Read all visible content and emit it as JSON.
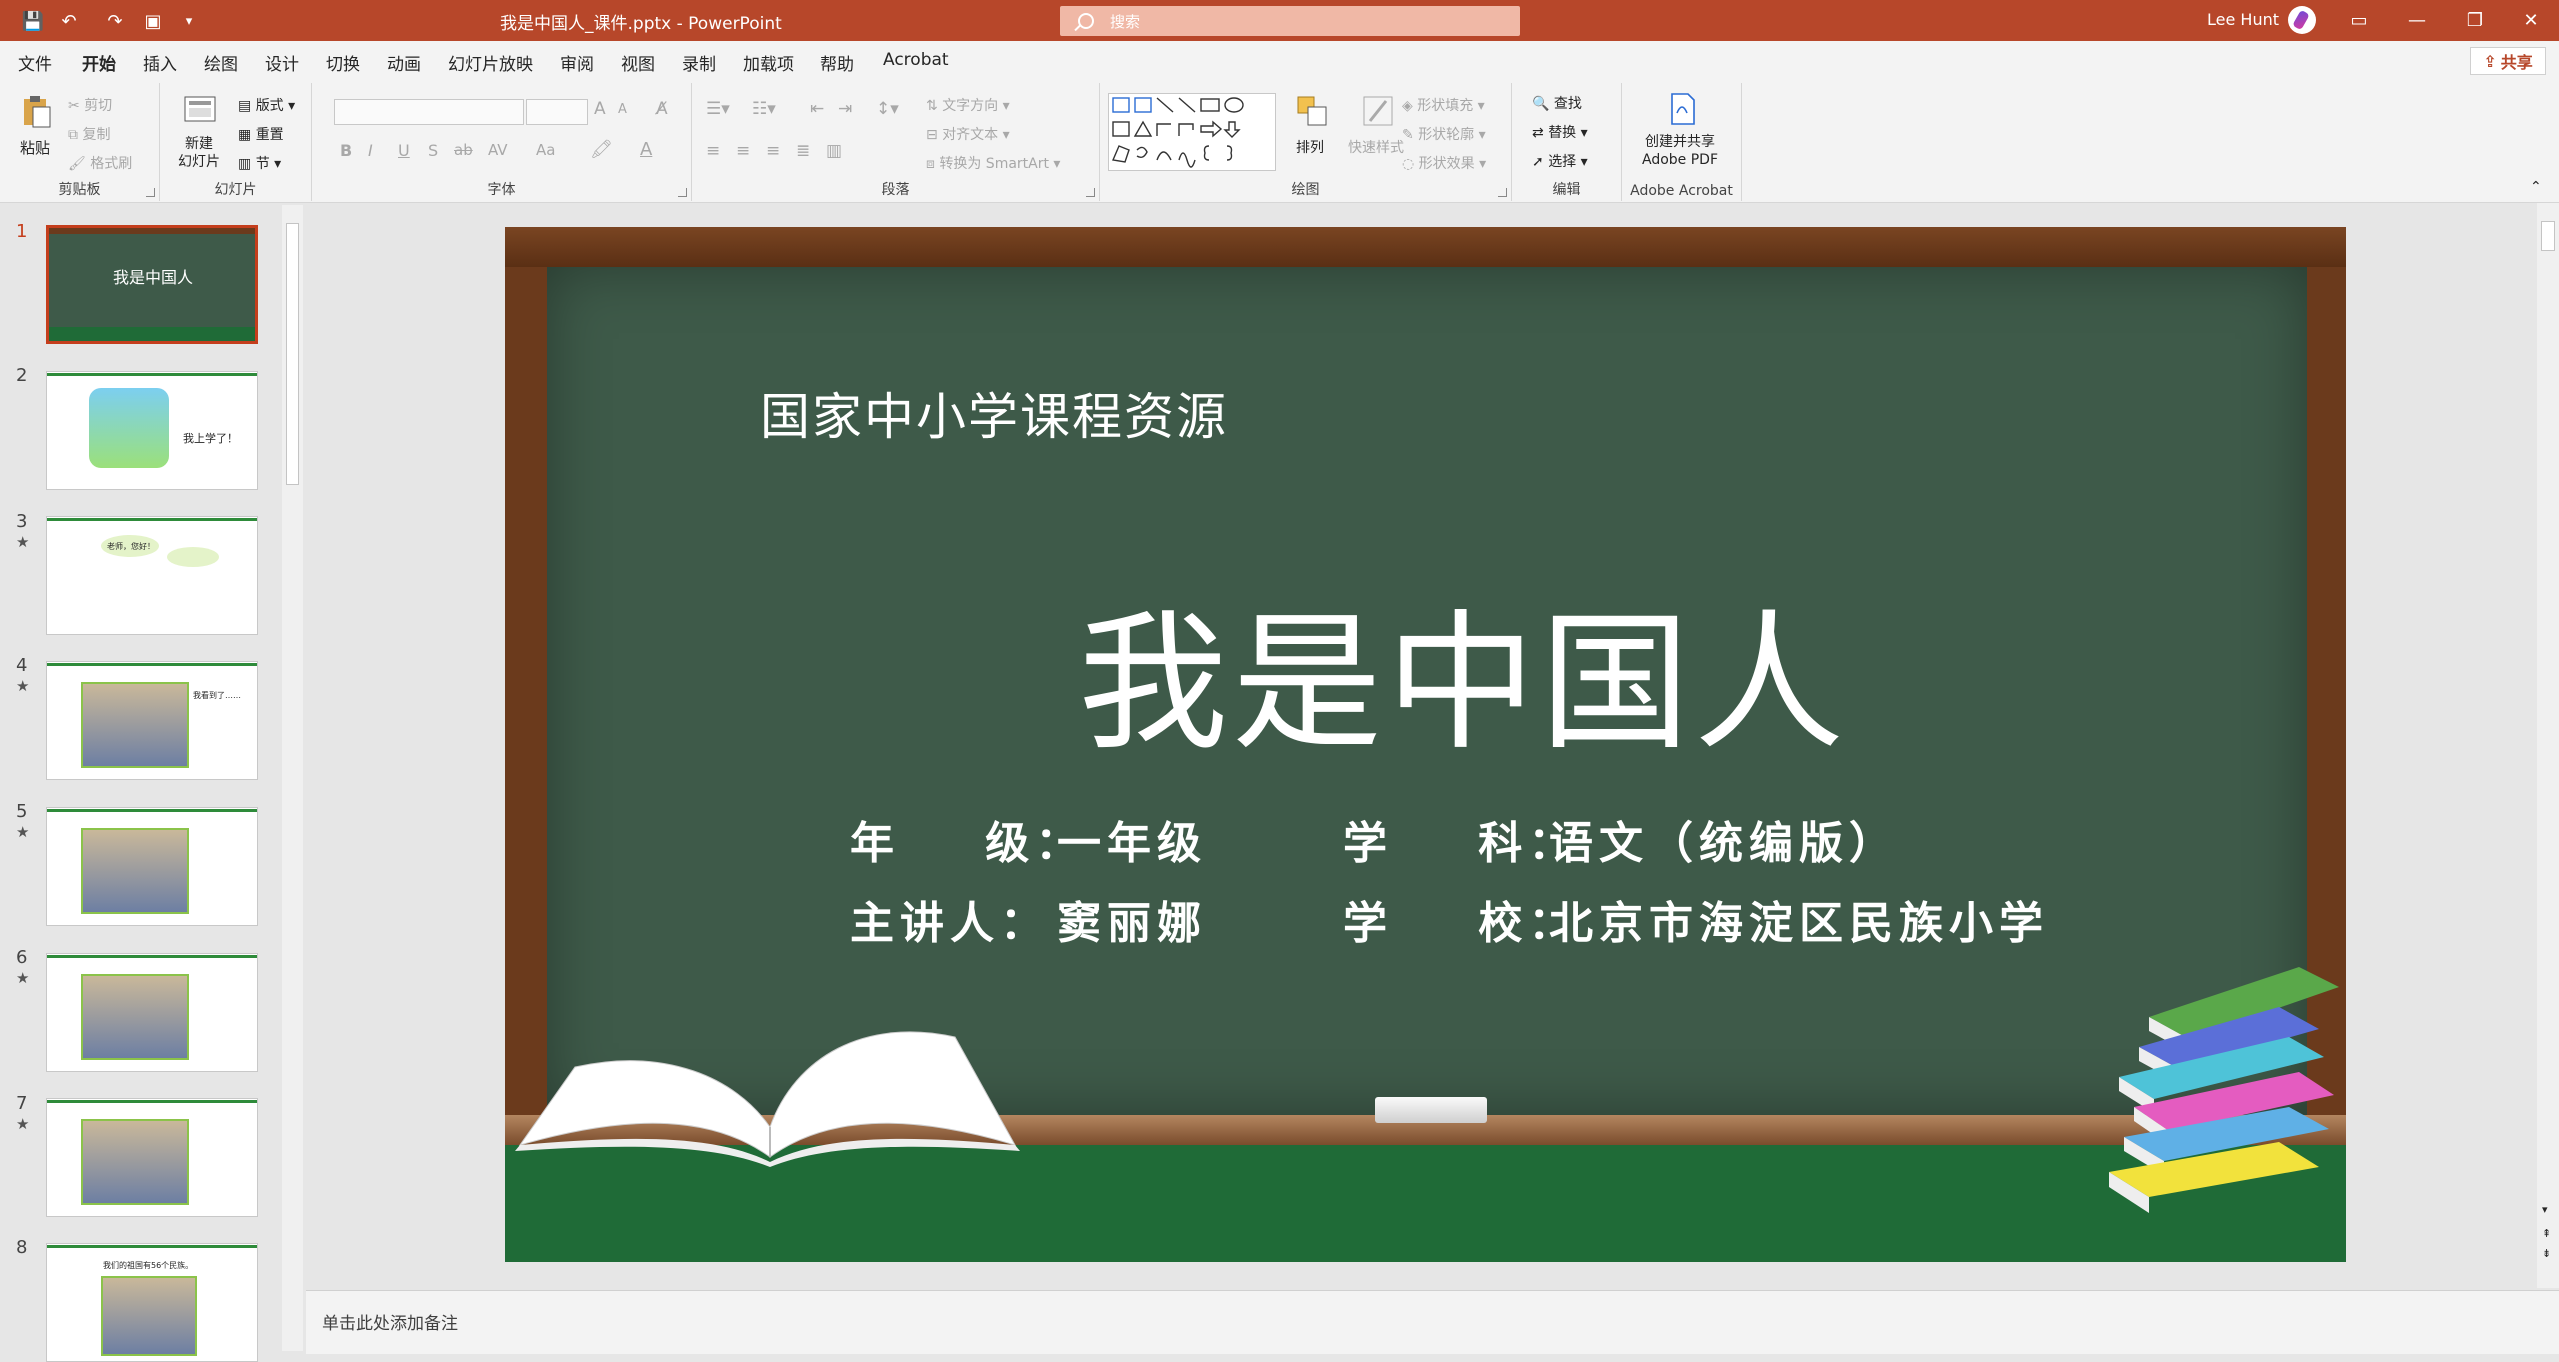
{
  "titlebar": {
    "doc_title": "我是中国人_课件.pptx  -  PowerPoint",
    "search_placeholder": "搜索",
    "user": "Lee Hunt",
    "minimize": "—",
    "restore": "❐",
    "close": "✕",
    "ribbon_display": "▭"
  },
  "tabs": [
    "文件",
    "开始",
    "插入",
    "绘图",
    "设计",
    "切换",
    "动画",
    "幻灯片放映",
    "审阅",
    "视图",
    "录制",
    "加载项",
    "帮助",
    "Acrobat"
  ],
  "share_label": "共享",
  "ribbon": {
    "clipboard": {
      "label": "剪贴板",
      "paste": "粘贴",
      "cut": "剪切",
      "copy": "复制",
      "format_painter": "格式刷"
    },
    "slides": {
      "label": "幻灯片",
      "new_slide": "新建\n幻灯片",
      "layout": "版式",
      "reset": "重置",
      "section": "节"
    },
    "font": {
      "label": "字体",
      "bold": "B",
      "italic": "I",
      "underline": "U",
      "shadow": "S",
      "strike": "ab",
      "spacing": "AV",
      "case": "Aa",
      "grow": "A",
      "shrink": "A"
    },
    "paragraph": {
      "label": "段落",
      "text_direction": "文字方向",
      "align_text": "对齐文本",
      "smartart": "转换为 SmartArt"
    },
    "drawing": {
      "label": "绘图",
      "arrange": "排列",
      "quick_styles": "快速样式",
      "shape_fill": "形状填充",
      "shape_outline": "形状轮廓",
      "shape_effects": "形状效果"
    },
    "editing": {
      "label": "编辑",
      "find": "查找",
      "replace": "替换",
      "select": "选择"
    },
    "acrobat": {
      "label": "Adobe Acrobat",
      "create": "创建并共享\nAdobe PDF"
    }
  },
  "thumbnails": [
    {
      "num": "1",
      "star": "",
      "caption": "我是中国人"
    },
    {
      "num": "2",
      "star": "",
      "caption": "我上学了！"
    },
    {
      "num": "3",
      "star": "★",
      "caption": "老师，您好！"
    },
    {
      "num": "4",
      "star": "★",
      "caption": "我看到了……"
    },
    {
      "num": "5",
      "star": "★",
      "caption": ""
    },
    {
      "num": "6",
      "star": "★",
      "caption": ""
    },
    {
      "num": "7",
      "star": "★",
      "caption": ""
    },
    {
      "num": "8",
      "star": "",
      "caption": "我们的祖国有56个民族。"
    }
  ],
  "slide": {
    "subtitle": "国家中小学课程资源",
    "title": "我是中国人",
    "grade_label": "年    级：",
    "grade_value": "一年级",
    "subject_label": "学    科：",
    "subject_value": "语文（统编版）",
    "teacher_label": "主讲人：",
    "teacher_value": "窦丽娜",
    "school_label": "学    校：",
    "school_value": "北京市海淀区民族小学"
  },
  "notes_placeholder": "单击此处添加备注",
  "colors": {
    "titlebar": "#b7472a",
    "board": "#3e5a49",
    "frame": "#6b3a1c"
  }
}
